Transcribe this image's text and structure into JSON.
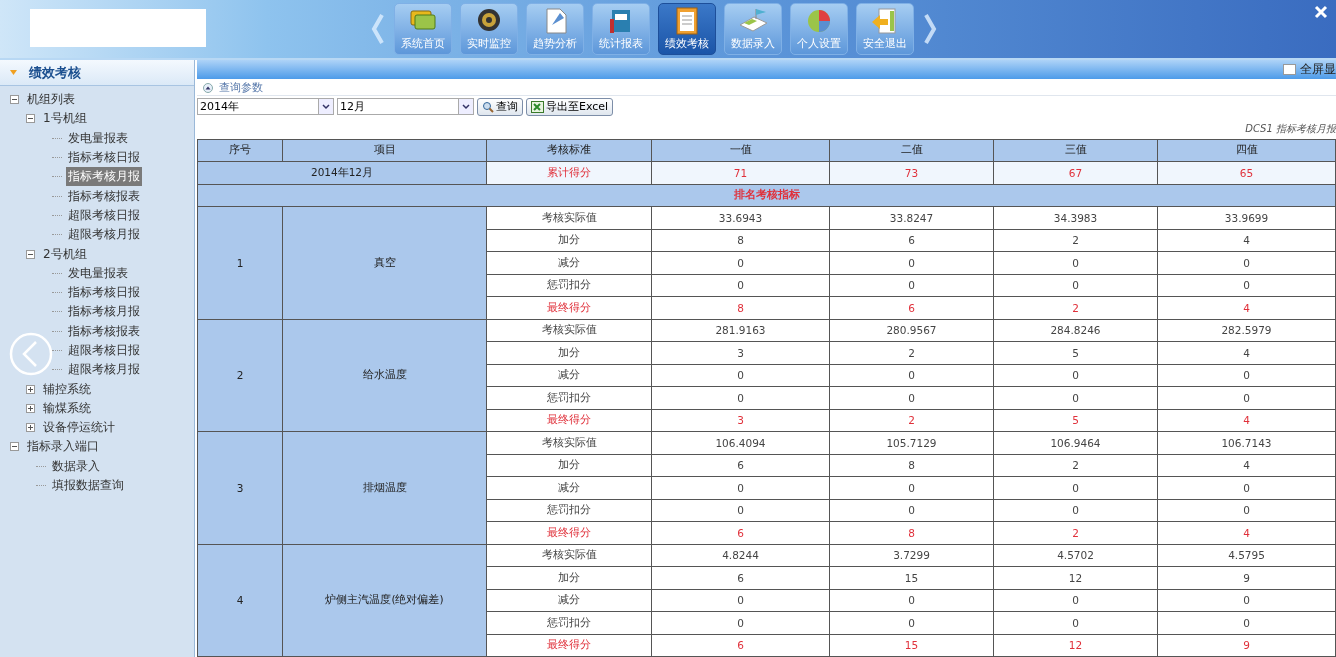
{
  "header": {
    "nav": [
      {
        "label": "系统首页",
        "selected": false
      },
      {
        "label": "实时监控",
        "selected": false
      },
      {
        "label": "趋势分析",
        "selected": false
      },
      {
        "label": "统计报表",
        "selected": false
      },
      {
        "label": "绩效考核",
        "selected": true
      },
      {
        "label": "数据录入",
        "selected": false
      },
      {
        "label": "个人设置",
        "selected": false
      },
      {
        "label": "安全退出",
        "selected": false
      }
    ]
  },
  "sidebar": {
    "title": "绩效考核",
    "tree": [
      {
        "label": "机组列表",
        "expanded": true,
        "selected": false,
        "children": [
          {
            "label": "1号机组",
            "expanded": true,
            "selected": false,
            "children": [
              {
                "label": "发电量报表",
                "selected": false
              },
              {
                "label": "指标考核日报",
                "selected": false
              },
              {
                "label": "指标考核月报",
                "selected": true
              },
              {
                "label": "指标考核报表",
                "selected": false
              },
              {
                "label": "超限考核日报",
                "selected": false
              },
              {
                "label": "超限考核月报",
                "selected": false
              }
            ]
          },
          {
            "label": "2号机组",
            "expanded": true,
            "selected": false,
            "children": [
              {
                "label": "发电量报表",
                "selected": false
              },
              {
                "label": "指标考核日报",
                "selected": false
              },
              {
                "label": "指标考核月报",
                "selected": false
              },
              {
                "label": "指标考核报表",
                "selected": false
              },
              {
                "label": "超限考核日报",
                "selected": false
              },
              {
                "label": "超限考核月报",
                "selected": false
              }
            ]
          },
          {
            "label": "辅控系统",
            "expanded": false,
            "selected": false
          },
          {
            "label": "输煤系统",
            "expanded": false,
            "selected": false
          },
          {
            "label": "设备停运统计",
            "expanded": false,
            "selected": false
          }
        ]
      },
      {
        "label": "指标录入端口",
        "expanded": true,
        "selected": false,
        "children": [
          {
            "label": "数据录入",
            "selected": false
          },
          {
            "label": "填报数据查询",
            "selected": false
          }
        ]
      }
    ]
  },
  "toolbar": {
    "fullscreen": {
      "label": "全屏显",
      "checked": false
    }
  },
  "query": {
    "legend": "查询参数",
    "year": "2014年",
    "month": "12月",
    "search_button": "查询",
    "export_button": "导出至Excel"
  },
  "report": {
    "title": "DCS1 指标考核月报",
    "columns": [
      "序号",
      "项目",
      "考核标准",
      "一值",
      "二值",
      "三值",
      "四值"
    ],
    "summary": {
      "period": "2014年12月",
      "standard": "累计得分",
      "values": [
        "71",
        "73",
        "67",
        "65"
      ]
    },
    "section": "排名考核指标",
    "groups": [
      {
        "index": "1",
        "item": "真空",
        "rows": [
          {
            "standard": "考核实际值",
            "emphasis": false,
            "values": [
              "33.6943",
              "33.8247",
              "34.3983",
              "33.9699"
            ]
          },
          {
            "standard": "加分",
            "emphasis": false,
            "values": [
              "8",
              "6",
              "2",
              "4"
            ]
          },
          {
            "standard": "减分",
            "emphasis": false,
            "values": [
              "0",
              "0",
              "0",
              "0"
            ]
          },
          {
            "standard": "惩罚扣分",
            "emphasis": false,
            "values": [
              "0",
              "0",
              "0",
              "0"
            ]
          },
          {
            "standard": "最终得分",
            "emphasis": true,
            "values": [
              "8",
              "6",
              "2",
              "4"
            ]
          }
        ]
      },
      {
        "index": "2",
        "item": "给水温度",
        "rows": [
          {
            "standard": "考核实际值",
            "emphasis": false,
            "values": [
              "281.9163",
              "280.9567",
              "284.8246",
              "282.5979"
            ]
          },
          {
            "standard": "加分",
            "emphasis": false,
            "values": [
              "3",
              "2",
              "5",
              "4"
            ]
          },
          {
            "standard": "减分",
            "emphasis": false,
            "values": [
              "0",
              "0",
              "0",
              "0"
            ]
          },
          {
            "standard": "惩罚扣分",
            "emphasis": false,
            "values": [
              "0",
              "0",
              "0",
              "0"
            ]
          },
          {
            "standard": "最终得分",
            "emphasis": true,
            "values": [
              "3",
              "2",
              "5",
              "4"
            ]
          }
        ]
      },
      {
        "index": "3",
        "item": "排烟温度",
        "rows": [
          {
            "standard": "考核实际值",
            "emphasis": false,
            "values": [
              "106.4094",
              "105.7129",
              "106.9464",
              "106.7143"
            ]
          },
          {
            "standard": "加分",
            "emphasis": false,
            "values": [
              "6",
              "8",
              "2",
              "4"
            ]
          },
          {
            "standard": "减分",
            "emphasis": false,
            "values": [
              "0",
              "0",
              "0",
              "0"
            ]
          },
          {
            "standard": "惩罚扣分",
            "emphasis": false,
            "values": [
              "0",
              "0",
              "0",
              "0"
            ]
          },
          {
            "standard": "最终得分",
            "emphasis": true,
            "values": [
              "6",
              "8",
              "2",
              "4"
            ]
          }
        ]
      },
      {
        "index": "4",
        "item": "炉侧主汽温度(绝对偏差)",
        "rows": [
          {
            "standard": "考核实际值",
            "emphasis": false,
            "values": [
              "4.8244",
              "3.7299",
              "4.5702",
              "4.5795"
            ]
          },
          {
            "standard": "加分",
            "emphasis": false,
            "values": [
              "6",
              "15",
              "12",
              "9"
            ]
          },
          {
            "standard": "减分",
            "emphasis": false,
            "values": [
              "0",
              "0",
              "0",
              "0"
            ]
          },
          {
            "standard": "惩罚扣分",
            "emphasis": false,
            "values": [
              "0",
              "0",
              "0",
              "0"
            ]
          },
          {
            "standard": "最终得分",
            "emphasis": true,
            "values": [
              "6",
              "15",
              "12",
              "9"
            ]
          }
        ]
      }
    ]
  }
}
